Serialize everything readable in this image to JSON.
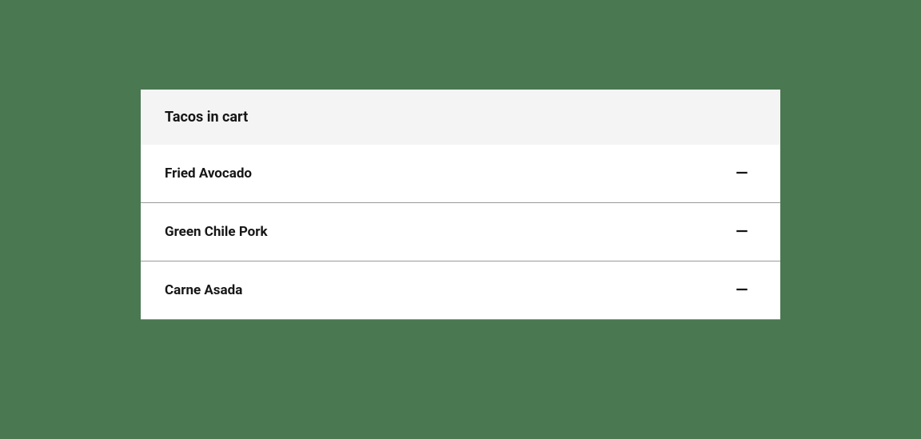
{
  "cart": {
    "title": "Tacos in cart",
    "items": [
      {
        "name": "Fried Avocado"
      },
      {
        "name": "Green Chile Pork"
      },
      {
        "name": "Carne Asada"
      }
    ]
  }
}
